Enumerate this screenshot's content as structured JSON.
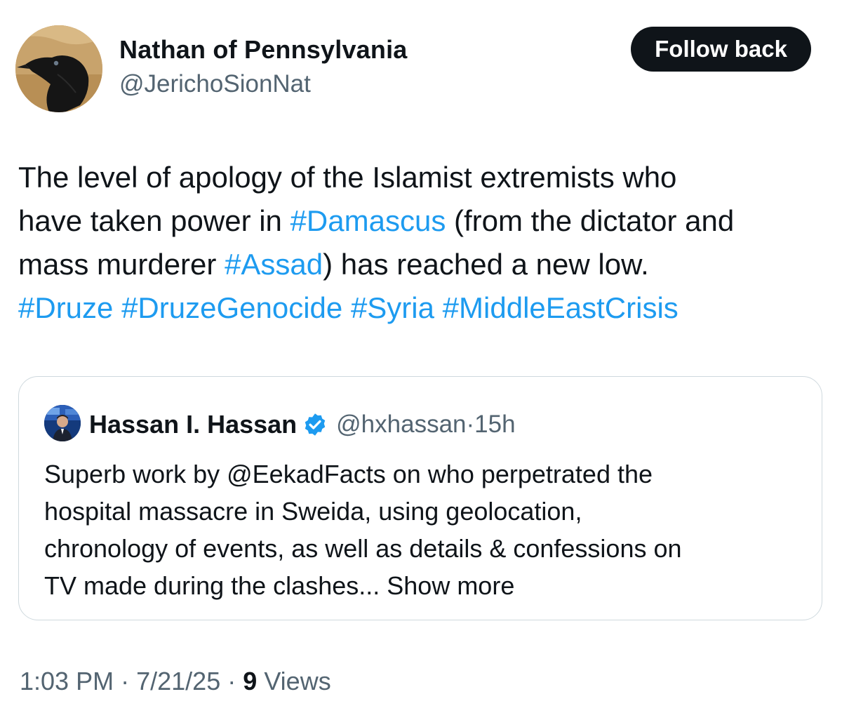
{
  "author": {
    "name": "Nathan of Pennsylvania",
    "handle": "@JerichoSionNat",
    "follow_label": "Follow back"
  },
  "tweet": {
    "lines": [
      [
        {
          "text": "The level of apology of the Islamist extremists who"
        }
      ],
      [
        {
          "text": "have taken power in "
        },
        {
          "text": "#Damascus",
          "hashtag": true
        },
        {
          "text": " (from the dictator and"
        }
      ],
      [
        {
          "text": "mass murderer "
        },
        {
          "text": "#Assad",
          "hashtag": true
        },
        {
          "text": ") has reached a new low."
        }
      ],
      [
        {
          "text": "#Druze",
          "hashtag": true
        },
        {
          "text": " "
        },
        {
          "text": "#DruzeGenocide",
          "hashtag": true
        },
        {
          "text": " "
        },
        {
          "text": "#Syria",
          "hashtag": true
        },
        {
          "text": " "
        },
        {
          "text": "#MiddleEastCrisis",
          "hashtag": true
        }
      ]
    ]
  },
  "quote": {
    "name": "Hassan I. Hassan",
    "handle": "@hxhassan",
    "separator": "·",
    "time": "15h",
    "lines": [
      "Superb work by @EekadFacts on who perpetrated the",
      "hospital massacre in Sweida, using geolocation,",
      "chronology of events, as well as details & confessions on",
      "TV made during the clashes..."
    ],
    "show_more": "Show more"
  },
  "meta": {
    "time": "1:03 PM",
    "separator": "·",
    "date": "7/21/25",
    "views_count": "9",
    "views_label": "Views"
  },
  "colors": {
    "hashtag": "#1d9bf0",
    "text": "#0f1419",
    "secondary": "#536471",
    "border": "#cfd9de",
    "button_bg": "#0f1419",
    "verified": "#1d9bf0"
  },
  "icons": {
    "author_avatar": "crow-avatar",
    "quote_avatar": "news-anchor-avatar",
    "verified": "verified-badge-icon"
  }
}
